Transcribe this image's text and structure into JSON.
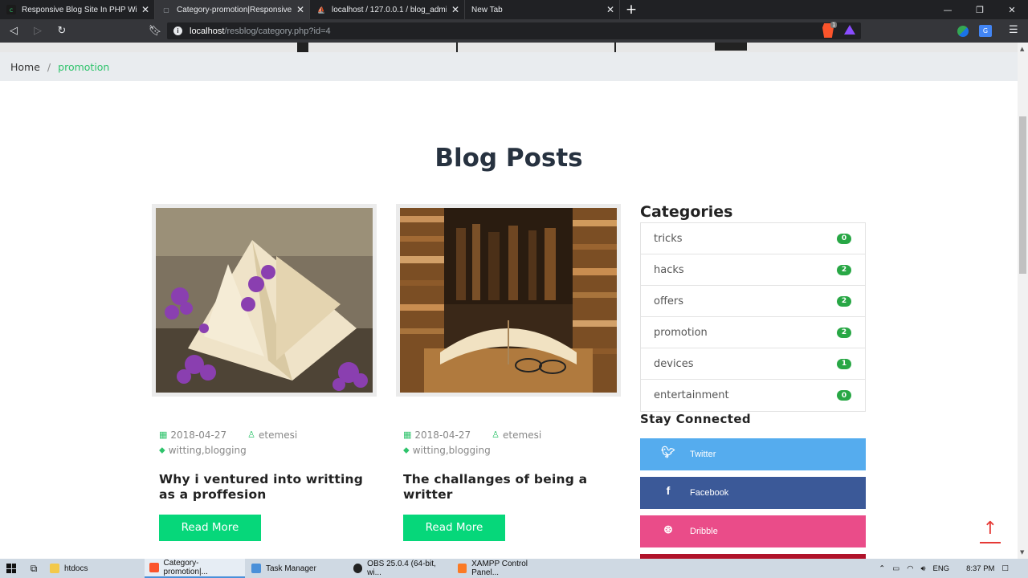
{
  "browser": {
    "tabs": [
      {
        "title": "Responsive Blog Site In PHP With ",
        "favicon": "c",
        "color": "#2ec36b",
        "active": false
      },
      {
        "title": "Category-promotion|Responsive B",
        "favicon": "▢",
        "color": "#9aa0a6",
        "active": true
      },
      {
        "title": "localhost / 127.0.0.1 / blog_admin_",
        "favicon": "⛵",
        "color": "#f6a21b",
        "active": false
      },
      {
        "title": "New Tab",
        "favicon": "",
        "color": "",
        "active": false
      }
    ],
    "url_host": "localhost",
    "url_path": "/resblog/category.php?id=4",
    "brave_badge": "1"
  },
  "breadcrumb": {
    "home": "Home",
    "separator": "/",
    "current": "promotion"
  },
  "section_title": "Blog Posts",
  "posts": [
    {
      "date": "2018-04-27",
      "author": "etemesi",
      "tags": "witting,blogging",
      "title": "Why i ventured into writting as a proffesion",
      "read_more": "Read More"
    },
    {
      "date": "2018-04-27",
      "author": "etemesi",
      "tags": "witting,blogging",
      "title": "The challanges of being a writter",
      "read_more": "Read More"
    }
  ],
  "sidebar": {
    "categories_title": "Categories",
    "categories": [
      {
        "name": "tricks",
        "count": "0"
      },
      {
        "name": "hacks",
        "count": "2"
      },
      {
        "name": "offers",
        "count": "2"
      },
      {
        "name": "promotion",
        "count": "2"
      },
      {
        "name": "devices",
        "count": "1"
      },
      {
        "name": "entertainment",
        "count": "0"
      }
    ],
    "stay_connected_title": "Stay Connected",
    "social": [
      {
        "label": "Twitter",
        "icon": "twitter-icon"
      },
      {
        "label": "Facebook",
        "icon": "facebook-icon"
      },
      {
        "label": "Dribble",
        "icon": "dribbble-icon"
      }
    ]
  },
  "taskbar": {
    "items": [
      {
        "label": "htdocs",
        "icon": "folder-icon",
        "color": "#f3c94a",
        "active": false
      },
      {
        "label": "Category-promotion|...",
        "icon": "brave-icon",
        "color": "#fb542b",
        "active": true
      },
      {
        "label": "Task Manager",
        "icon": "task-manager-icon",
        "color": "#4a90d9",
        "active": false
      },
      {
        "label": "OBS 25.0.4 (64-bit, wi...",
        "icon": "obs-icon",
        "color": "#222222",
        "active": false
      },
      {
        "label": "XAMPP Control Panel...",
        "icon": "xampp-icon",
        "color": "#fb7a24",
        "active": false
      }
    ],
    "language": "ENG",
    "time": "8:37 PM"
  },
  "colors": {
    "accent": "#06d77a",
    "badge": "#28a745",
    "twitter": "#55acee",
    "facebook": "#3b5998",
    "dribbble": "#ea4c89"
  }
}
